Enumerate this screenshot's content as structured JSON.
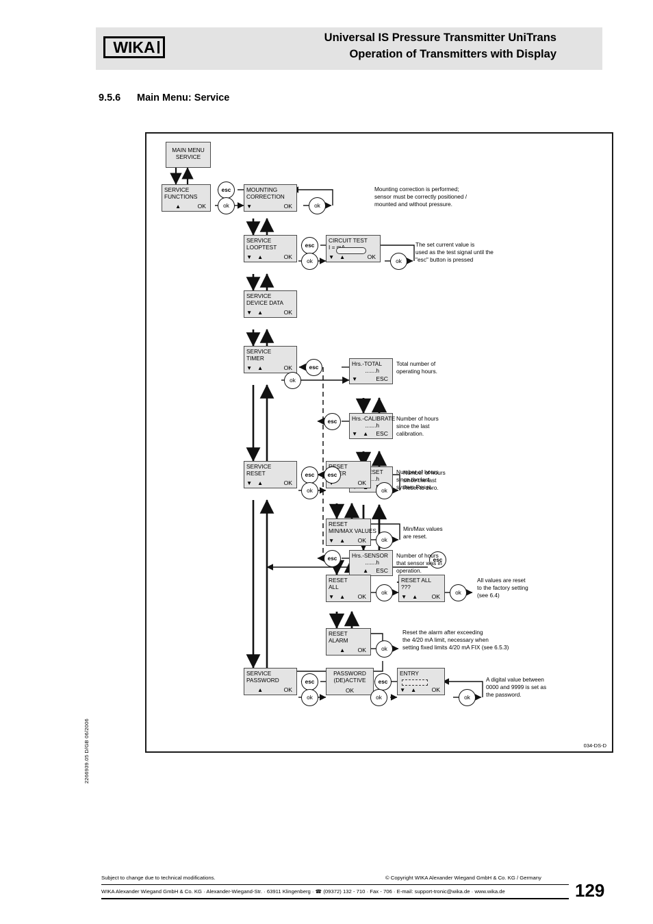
{
  "header": {
    "logo_text": "WIKA",
    "title_line1": "Universal IS Pressure Transmitter UniTrans",
    "title_line2": "Operation of Transmitters with Display"
  },
  "section": {
    "number": "9.5.6",
    "title": "Main Menu: Service"
  },
  "diagram": {
    "id": "034-DS-D",
    "keys": {
      "ok": "ok",
      "esc": "esc",
      "OK": "OK",
      "ESC": "ESC",
      "down": "▼",
      "up": "▲"
    },
    "boxes": [
      {
        "id": "main-menu",
        "l1": "MAIN MENU",
        "l2": "SERVICE",
        "keys": ""
      },
      {
        "id": "service-functions",
        "l1": "SERVICE",
        "l2": "FUNCTIONS",
        "keys": "up-ok"
      },
      {
        "id": "mounting-correction",
        "l1": "MOUNTING",
        "l2": "CORRECTION",
        "keys": "dn-ok"
      },
      {
        "id": "service-looptest",
        "l1": "SERVICE",
        "l2": "LOOPTEST",
        "keys": "dn-up-ok"
      },
      {
        "id": "circuit-test",
        "l1": "CIRCUIT TEST",
        "l2": "I =            mA",
        "keys": "dn-up-ok"
      },
      {
        "id": "service-device-data",
        "l1": "SERVICE",
        "l2": "DEVICE DATA",
        "keys": "dn-up-ok"
      },
      {
        "id": "service-timer",
        "l1": "SERVICE",
        "l2": "TIMER",
        "keys": "dn-up-ok"
      },
      {
        "id": "hrs-total",
        "l1": "Hrs.-TOTAL",
        "l2": ".......h",
        "keys": "dn-esc"
      },
      {
        "id": "hrs-calibrate",
        "l1": "Hrs.-CALIBRATE",
        "l2": ".......h",
        "keys": "dn-up-esc"
      },
      {
        "id": "hrs-reset",
        "l1": "Hrs.-RESET",
        "l2": ".......h",
        "keys": "dn-up-esc"
      },
      {
        "id": "hrs-sensor",
        "l1": "Hrs.-SENSOR",
        "l2": ".......h",
        "keys": "up-esc"
      },
      {
        "id": "service-reset",
        "l1": "SERVICE",
        "l2": "RESET",
        "keys": "dn-up-ok"
      },
      {
        "id": "reset-timer",
        "l1": "RESET",
        "l2": "TIMER",
        "keys": "dn-ok"
      },
      {
        "id": "reset-minmax",
        "l1": "RESET",
        "l2": "MIN/MAX VALUES",
        "keys": "dn-up-ok"
      },
      {
        "id": "reset-all",
        "l1": "RESET",
        "l2": "ALL",
        "keys": "dn-up-ok"
      },
      {
        "id": "reset-all-confirm",
        "l1": "RESET ALL",
        "l2": "???",
        "keys": "dn-up-ok"
      },
      {
        "id": "reset-alarm",
        "l1": "RESET",
        "l2": "ALARM",
        "keys": "up-ok"
      },
      {
        "id": "service-password",
        "l1": "SERVICE",
        "l2": "PASSWORD",
        "keys": "up-ok"
      },
      {
        "id": "password-deactive",
        "l1": "PASSWORD",
        "l2": "(DE)ACTIVE",
        "keys": "ok-center"
      },
      {
        "id": "entry",
        "l1": "ENTRY",
        "l2": "",
        "keys": "dn-up-ok"
      }
    ],
    "notes": {
      "mounting": "Mounting correction is performed;\nsensor must be correctly positioned /\nmounted and without pressure.",
      "circuit_test": "The set current value is\nused as the test signal until the\n\"esc\" button is pressed",
      "hrs_total": "Total number of\noperating hours.",
      "hrs_calibrate": "Number of hours\nsince the last\ncalibration.",
      "hrs_reset": "Number of hours\nsince the last\nsystem Reset.",
      "hrs_sensor": "Number of hours\nthat sensor was in\noperation.",
      "reset_timer": "Number of hours\nsince the last\nReset to zero.",
      "reset_minmax": "Min/Max values\nare reset.",
      "reset_all": "All values are reset\nto the factory setting\n(see 6.4)",
      "reset_alarm": "Reset the alarm after exceeding\nthe 4/20 mA limit, necessary when\nsetting fixed limits 4/20 mA FIX (see 6.5.3)",
      "password": "A digital value between\n0000 and 9999 is set as\nthe password."
    }
  },
  "side_code": "2266939.05 D/GB 06/2006",
  "footer": {
    "modifications": "Subject to change due to technical modifications.",
    "copyright": "© Copyright WIKA Alexander Wiegand GmbH & Co. KG / Germany",
    "address": "WIKA Alexander Wiegand GmbH & Co. KG · Alexander-Wiegand-Str. · 63911 Klingenberg · ☎ (09372) 132 - 710 · Fax - 706 · E-mail: support-tronic@wika.de · www.wika.de",
    "page": "129"
  }
}
